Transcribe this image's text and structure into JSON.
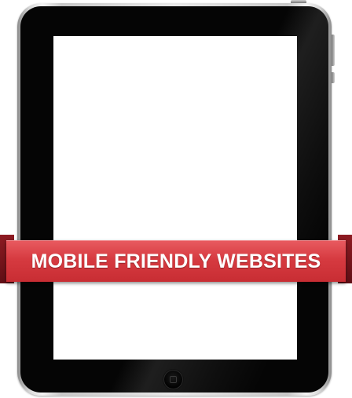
{
  "banner": {
    "text": "MOBILE FRIENDLY WEBSITES",
    "color": "#d63a40",
    "text_color": "#ffffff"
  },
  "device": {
    "type": "tablet",
    "bezel_color": "#050505",
    "screen_color": "#ffffff",
    "frame_color": "#c8c8c8"
  },
  "icons": {
    "home_button": "home-button-icon"
  }
}
